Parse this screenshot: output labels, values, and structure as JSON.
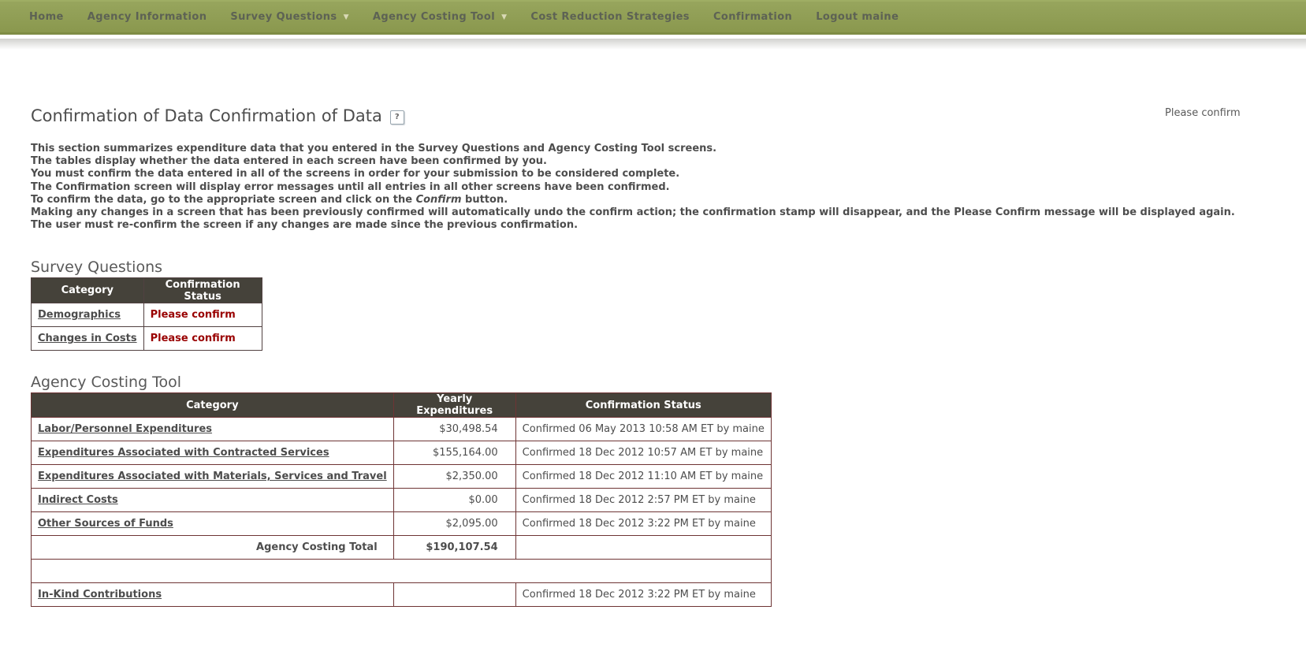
{
  "nav": {
    "items": [
      {
        "label": "Home",
        "has_dropdown": false
      },
      {
        "label": "Agency Information",
        "has_dropdown": false
      },
      {
        "label": "Survey Questions",
        "has_dropdown": true
      },
      {
        "label": "Agency Costing Tool",
        "has_dropdown": true
      },
      {
        "label": "Cost Reduction Strategies",
        "has_dropdown": false
      },
      {
        "label": "Confirmation",
        "has_dropdown": false
      },
      {
        "label": "Logout maine",
        "has_dropdown": false
      }
    ],
    "dropdown_arrow": "▼"
  },
  "header": {
    "title": "Confirmation of Data Confirmation of Data",
    "help_label": "?",
    "top_right_notice": "Please confirm"
  },
  "intro": {
    "line1": "This section summarizes expenditure data that you entered in the Survey Questions and Agency Costing Tool screens.",
    "line2": "The tables display whether the data entered in each screen have been confirmed by you.",
    "line3": "You must confirm the data entered in all of the screens in order for your submission to be considered complete.",
    "line4": "The Confirmation screen will display error messages until all entries in all other screens have been confirmed.",
    "line5_pre": "To confirm the data, go to the appropriate screen and click on the ",
    "line5_italic": "Confirm",
    "line5_post": " button.",
    "line6": "Making any changes in a screen that has been previously confirmed will automatically undo the confirm action; the confirmation stamp will disappear, and the Please Confirm message will be displayed again.",
    "line7": "The user must re-confirm the screen if any changes are made since the previous confirmation."
  },
  "survey_questions": {
    "heading": "Survey Questions",
    "columns": [
      "Category",
      "Confirmation Status"
    ],
    "rows": [
      {
        "category": "Demographics",
        "status": "Please confirm"
      },
      {
        "category": "Changes in Costs",
        "status": "Please confirm"
      }
    ]
  },
  "agency_costing_tool": {
    "heading": "Agency Costing Tool",
    "columns": [
      "Category",
      "Yearly Expenditures",
      "Confirmation Status"
    ],
    "rows": [
      {
        "category": "Labor/Personnel Expenditures",
        "amount": "$30,498.54",
        "status": "Confirmed 06 May 2013 10:58 AM ET by maine"
      },
      {
        "category": "Expenditures Associated with Contracted Services",
        "amount": "$155,164.00",
        "status": "Confirmed 18 Dec 2012 10:57 AM ET by maine"
      },
      {
        "category": "Expenditures Associated with Materials, Services and Travel",
        "amount": "$2,350.00",
        "status": "Confirmed 18 Dec 2012 11:10 AM ET by maine"
      },
      {
        "category": "Indirect Costs",
        "amount": "$0.00",
        "status": "Confirmed 18 Dec 2012 2:57 PM ET by maine"
      },
      {
        "category": "Other Sources of Funds",
        "amount": "$2,095.00",
        "status": "Confirmed 18 Dec 2012 3:22 PM ET by maine"
      }
    ],
    "total_row": {
      "label": "Agency Costing Total",
      "amount": "$190,107.54"
    },
    "extra_row": {
      "category": "In-Kind Contributions",
      "amount": "",
      "status": "Confirmed 18 Dec 2012 3:22 PM ET by maine"
    }
  },
  "colors": {
    "nav_background": "#8c9a52",
    "table_header_background": "#45423a",
    "agency_table_border": "#6e3434",
    "error_text": "#990000",
    "body_text": "#4d4d4d"
  }
}
